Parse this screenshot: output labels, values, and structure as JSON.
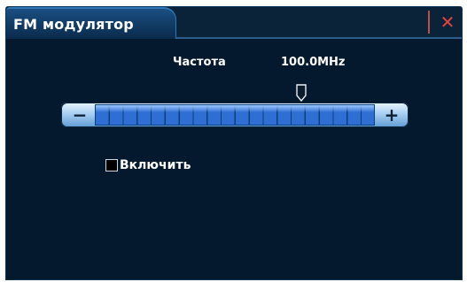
{
  "window": {
    "title": "FM модулятор",
    "close_glyph": "✕"
  },
  "frequency": {
    "label": "Частота",
    "value_text": "100.0MHz",
    "slider_position_fraction": 0.74
  },
  "slider": {
    "minus_glyph": "−",
    "plus_glyph": "+"
  },
  "enable": {
    "label": "Включить",
    "checked": false
  },
  "colors": {
    "background": "#04192e",
    "accent": "#2f6fd4",
    "close": "#e7423f"
  },
  "icons": [
    "close-icon",
    "minus-icon",
    "plus-icon",
    "slider-thumb"
  ]
}
